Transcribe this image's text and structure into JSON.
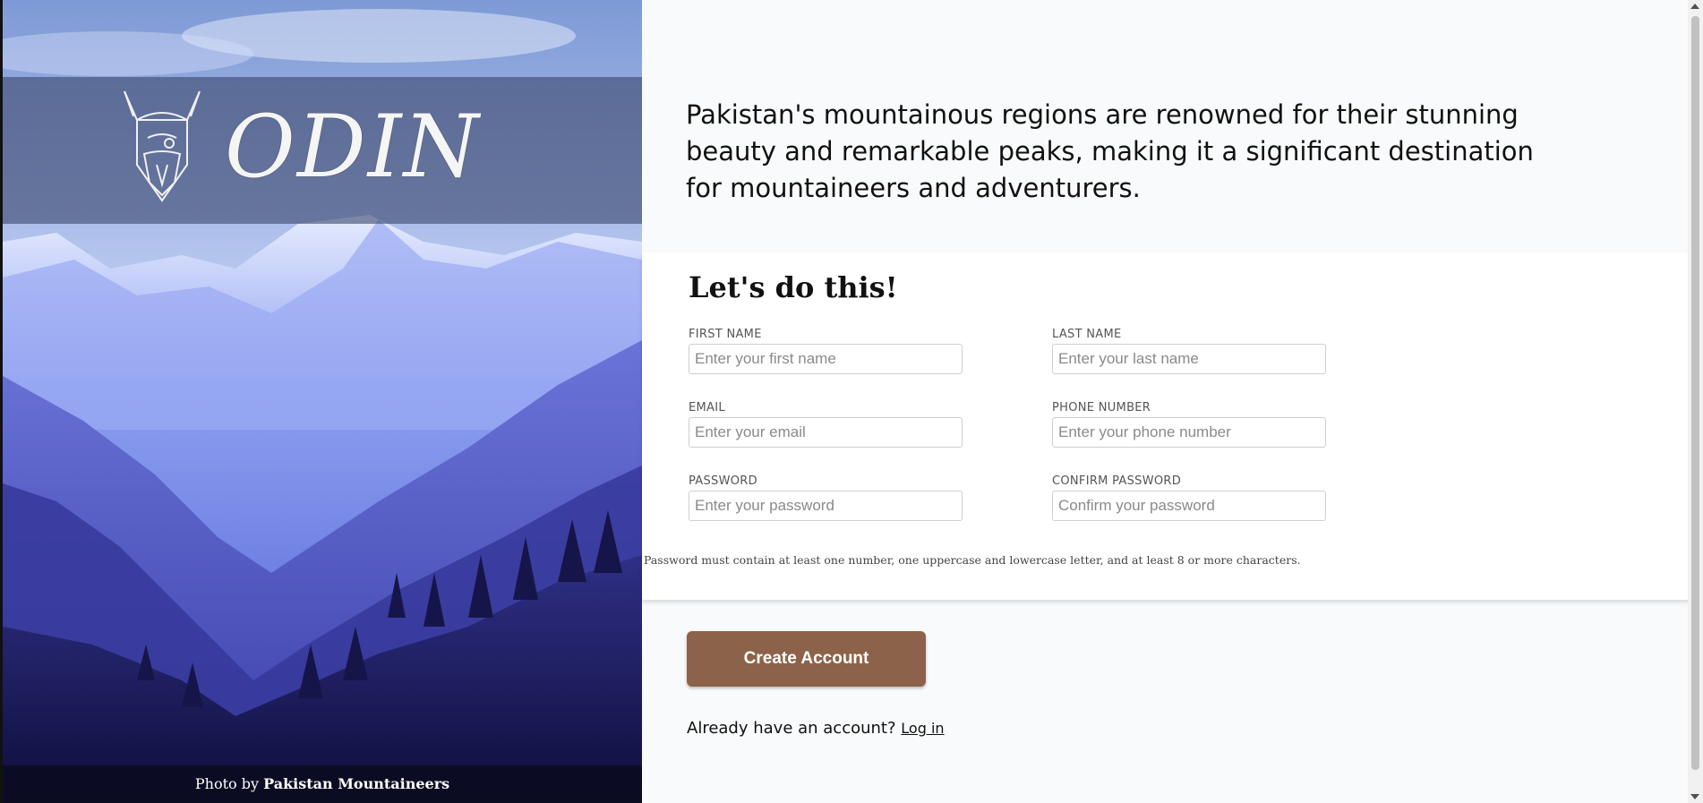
{
  "brand": {
    "logo_text": "ODIN"
  },
  "credit": {
    "prefix": "Photo by",
    "author": "Pakistan Mountaineers"
  },
  "intro_text": "Pakistan's mountainous regions are renowned for their stunning beauty and remarkable peaks, making it a significant destination for mountaineers and adventurers.",
  "form": {
    "title": "Let's do this!",
    "fields": {
      "first_name": {
        "label": "FIRST NAME",
        "placeholder": "Enter your first name",
        "value": ""
      },
      "last_name": {
        "label": "LAST NAME",
        "placeholder": "Enter your last name",
        "value": ""
      },
      "email": {
        "label": "EMAIL",
        "placeholder": "Enter your email",
        "value": ""
      },
      "phone": {
        "label": "PHONE NUMBER",
        "placeholder": "Enter your phone number",
        "value": ""
      },
      "password": {
        "label": "PASSWORD",
        "placeholder": "Enter your password",
        "value": ""
      },
      "confirm_password": {
        "label": "CONFIRM PASSWORD",
        "placeholder": "Confirm your password",
        "value": ""
      }
    },
    "password_hint": "Password must contain at least one number, one uppercase and lowercase letter, and at least 8 or more characters."
  },
  "actions": {
    "create_account": "Create Account",
    "login_prompt": "Already have an account?",
    "login_link": "Log in"
  },
  "colors": {
    "button": "#8c634a",
    "page_background": "#f9fafb",
    "card_background": "#ffffff"
  },
  "icons": {
    "logo_mark": "viking-helmet-icon"
  }
}
